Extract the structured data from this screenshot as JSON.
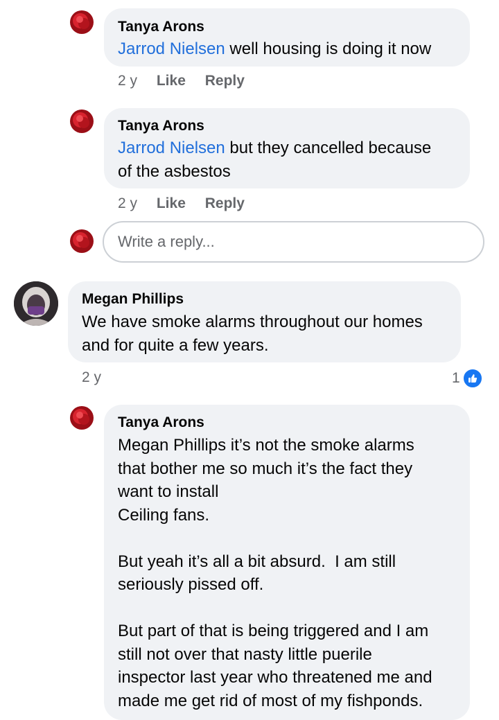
{
  "comments": [
    {
      "author": "Tanya Arons",
      "mention": "Jarrod Nielsen",
      "text": " well housing is doing it now",
      "time": "2 y",
      "like_label": "Like",
      "reply_label": "Reply"
    },
    {
      "author": "Tanya Arons",
      "mention": "Jarrod Nielsen",
      "text_line1": " but they cancelled because",
      "text_line2": "of the asbestos",
      "time": "2 y",
      "like_label": "Like",
      "reply_label": "Reply"
    },
    {
      "author": "Megan Phillips",
      "text": "We have smoke alarms throughout our homes\nand for quite a few years.",
      "time": "2 y",
      "reaction_count": "1"
    },
    {
      "author": "Tanya Arons",
      "text": "Megan Phillips it’s not the smoke alarms\nthat bother me so much it’s the fact they\nwant to install\nCeiling fans.\n\nBut yeah it’s all a bit absurd.  I am still\nseriously pissed off.\n\nBut part of that is being triggered and I am\nstill not over that nasty little puerile\ninspector last year who threatened me and\nmade me get rid of most of my fishponds."
    }
  ],
  "reply_box": {
    "placeholder": "Write a reply..."
  },
  "icons": {
    "avatar_tanya": "red-rose-avatar",
    "avatar_megan": "hooded-person-avatar",
    "like_reaction": "thumbs-up-icon"
  },
  "colors": {
    "mention": "#216fdb",
    "bubble": "#f0f2f5",
    "meta": "#65676b",
    "like_badge": "#1877f2"
  }
}
